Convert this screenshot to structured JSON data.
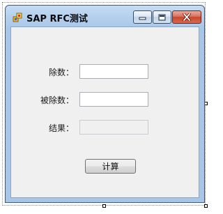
{
  "window": {
    "title": "SAP RFC测试",
    "controls": {
      "minimize_icon": "minimize-icon",
      "maximize_icon": "maximize-icon",
      "close_icon": "close-icon"
    }
  },
  "form": {
    "divisor_label": "除数：",
    "divisor_value": "",
    "dividend_label": "被除数：",
    "dividend_value": "",
    "result_label": "结果：",
    "result_value": "",
    "calculate_label": "计算"
  },
  "colors": {
    "title_gradient_top": "#c6dcf3",
    "client_bg": "#f0f0f0",
    "close_red": "#c6462b"
  }
}
